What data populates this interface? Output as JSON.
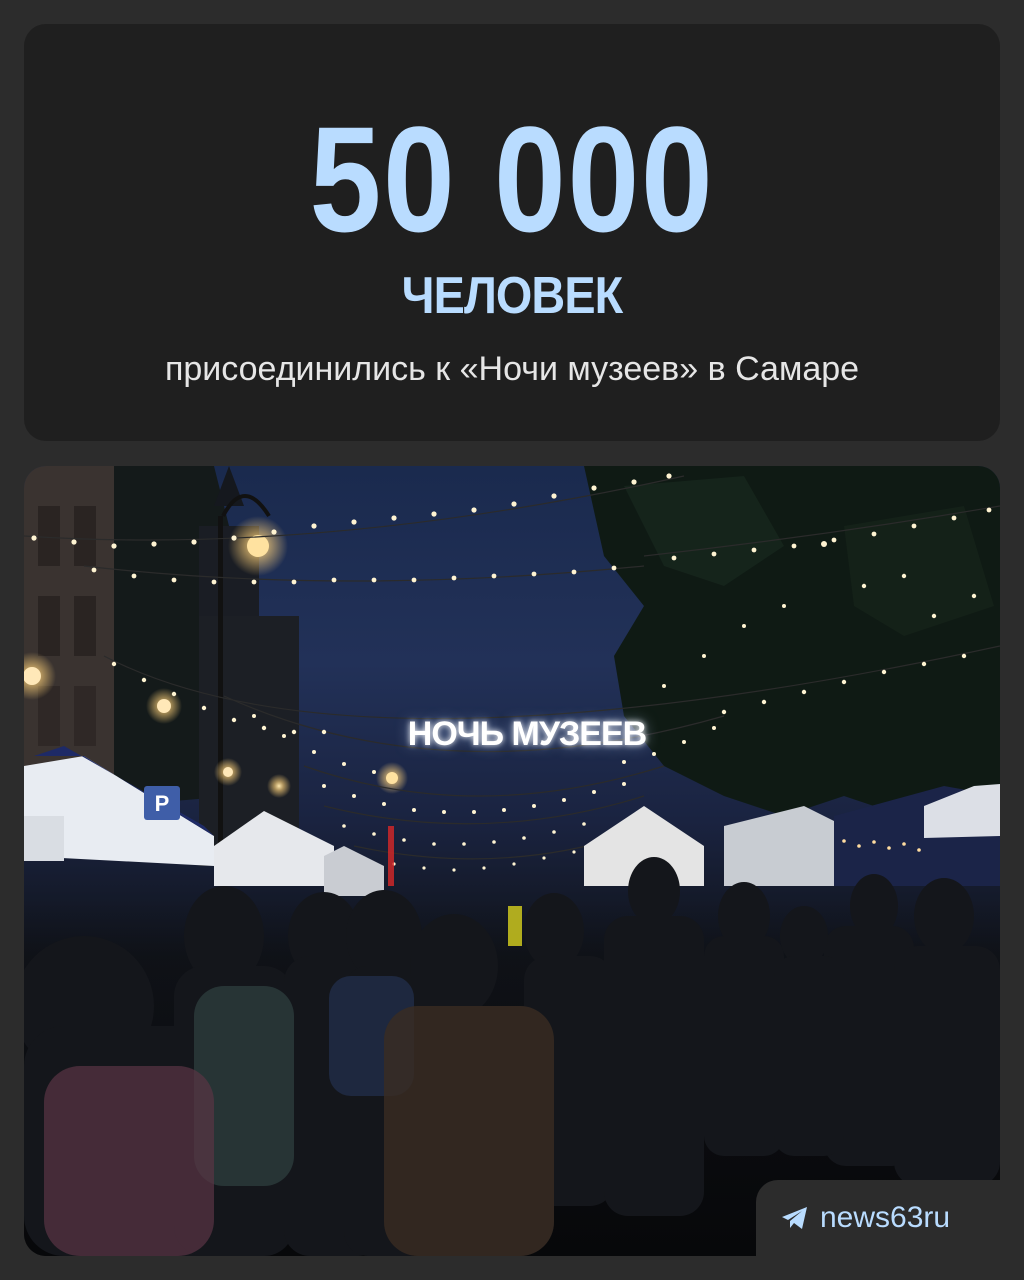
{
  "headline": {
    "number": "50 000",
    "unit": "ЧЕЛОВЕК",
    "caption": "присоединились к «Ночи музеев» в Самаре"
  },
  "photo": {
    "banner_text": "НОЧЬ МУЗЕЕВ",
    "scene": "night street crowd with string lights"
  },
  "credit": {
    "icon": "telegram-icon",
    "handle": "news63ru"
  },
  "colors": {
    "accent": "#b9dcff",
    "card": "#1f1f1f",
    "background": "#2c2c2c"
  }
}
